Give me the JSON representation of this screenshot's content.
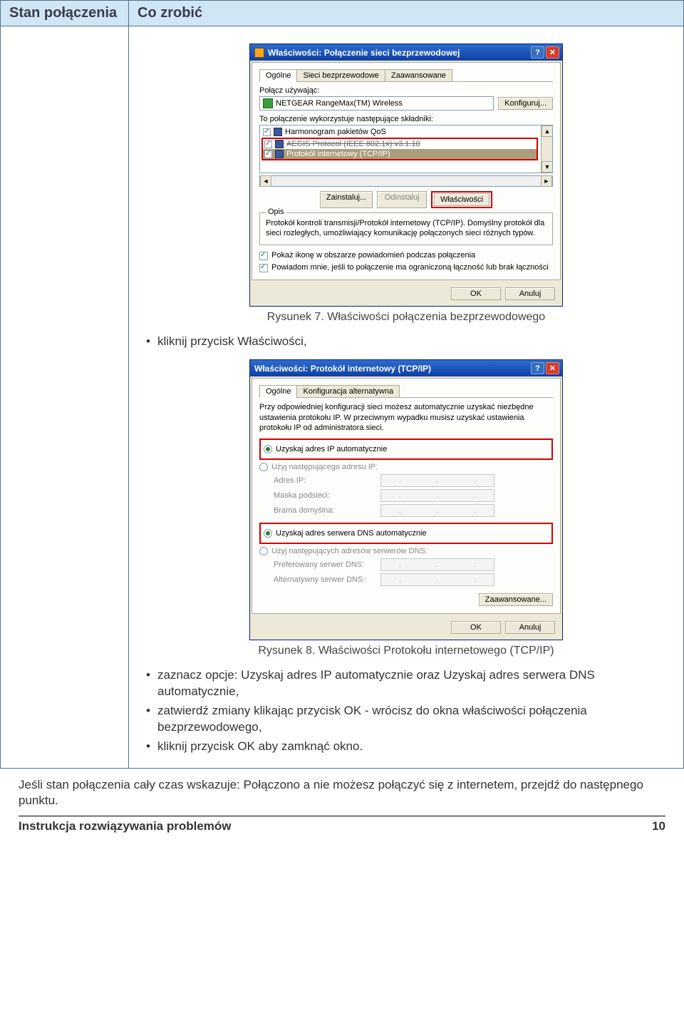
{
  "header": {
    "th_left": "Stan połączenia",
    "th_right": "Co zrobić"
  },
  "dialog1": {
    "title": "Właściwości: Połączenie sieci bezprzewodowej",
    "help_glyph": "?",
    "close_glyph": "✕",
    "tabs": [
      "Ogólne",
      "Sieci bezprzewodowe",
      "Zaawansowane"
    ],
    "connect_using_label": "Połącz używając:",
    "device_name": "NETGEAR RangeMax(TM) Wireless",
    "configure_btn": "Konfiguruj...",
    "components_label": "To połączenie wykorzystuje następujące składniki:",
    "items": {
      "qos": "Harmonogram pakietów QoS",
      "aegis": "AEGIS Protocol (IEEE 802.1x) v3.1.10",
      "tcpip": "Protokół internetowy (TCP/IP)"
    },
    "scroll_up": "▲",
    "scroll_down": "▼",
    "hleft": "◄",
    "hright": "►",
    "install_btn": "Zainstaluj...",
    "uninstall_btn": "Odinstaluj",
    "props_btn": "Właściwości",
    "desc_legend": "Opis",
    "desc_text": "Protokół kontroli transmisji/Protokół internetowy (TCP/IP). Domyślny protokół dla sieci rozległych, umożliwiający komunikację połączonych sieci różnych typów.",
    "show_icon": "Pokaż ikonę w obszarze powiadomień podczas połączenia",
    "notify_limited": "Powiadom mnie, jeśli to połączenie ma ograniczoną łączność lub brak łączności",
    "ok": "OK",
    "cancel": "Anuluj"
  },
  "fig7": "Rysunek 7. Właściwości połączenia bezprzewodowego",
  "step1": "kliknij przycisk Właściwości,",
  "dialog2": {
    "title": "Właściwości: Protokół internetowy (TCP/IP)",
    "help_glyph": "?",
    "close_glyph": "✕",
    "tabs": [
      "Ogólne",
      "Konfiguracja alternatywna"
    ],
    "intro": "Przy odpowiedniej konfiguracji sieci możesz automatycznie uzyskać niezbędne ustawienia protokołu IP. W przeciwnym wypadku musisz uzyskać ustawienia protokołu IP od administratora sieci.",
    "auto_ip": "Uzyskaj adres IP automatycznie",
    "use_ip": "Użyj następującego adresu IP:",
    "ip_label": "Adres IP:",
    "mask_label": "Maska podsieci:",
    "gw_label": "Brama domyślna:",
    "auto_dns": "Uzyskaj adres serwera DNS automatycznie",
    "use_dns": "Użyj następujących adresów serwerów DNS:",
    "pref_dns": "Preferowany serwer DNS:",
    "alt_dns": "Alternatywny serwer DNS:",
    "advanced": "Zaawansowane...",
    "ok": "OK",
    "cancel": "Anuluj"
  },
  "fig8": "Rysunek 8. Właściwości Protokołu internetowego (TCP/IP)",
  "steps_after": {
    "s1": "zaznacz opcje: Uzyskaj adres IP  automatycznie oraz Uzyskaj adres serwera DNS automatycznie,",
    "s2": "zatwierdź zmiany klikając przycisk OK  - wrócisz do okna właściwości połączenia bezprzewodowego,",
    "s3": "kliknij przycisk OK  aby zamknąć okno."
  },
  "bottom_note": "Jeśli stan połączenia cały czas  wskazuje: Połączono a nie możesz połączyć się z internetem, przejdź do następnego punktu.",
  "footer": {
    "left": "Instrukcja rozwiązywania problemów",
    "right": "10"
  }
}
